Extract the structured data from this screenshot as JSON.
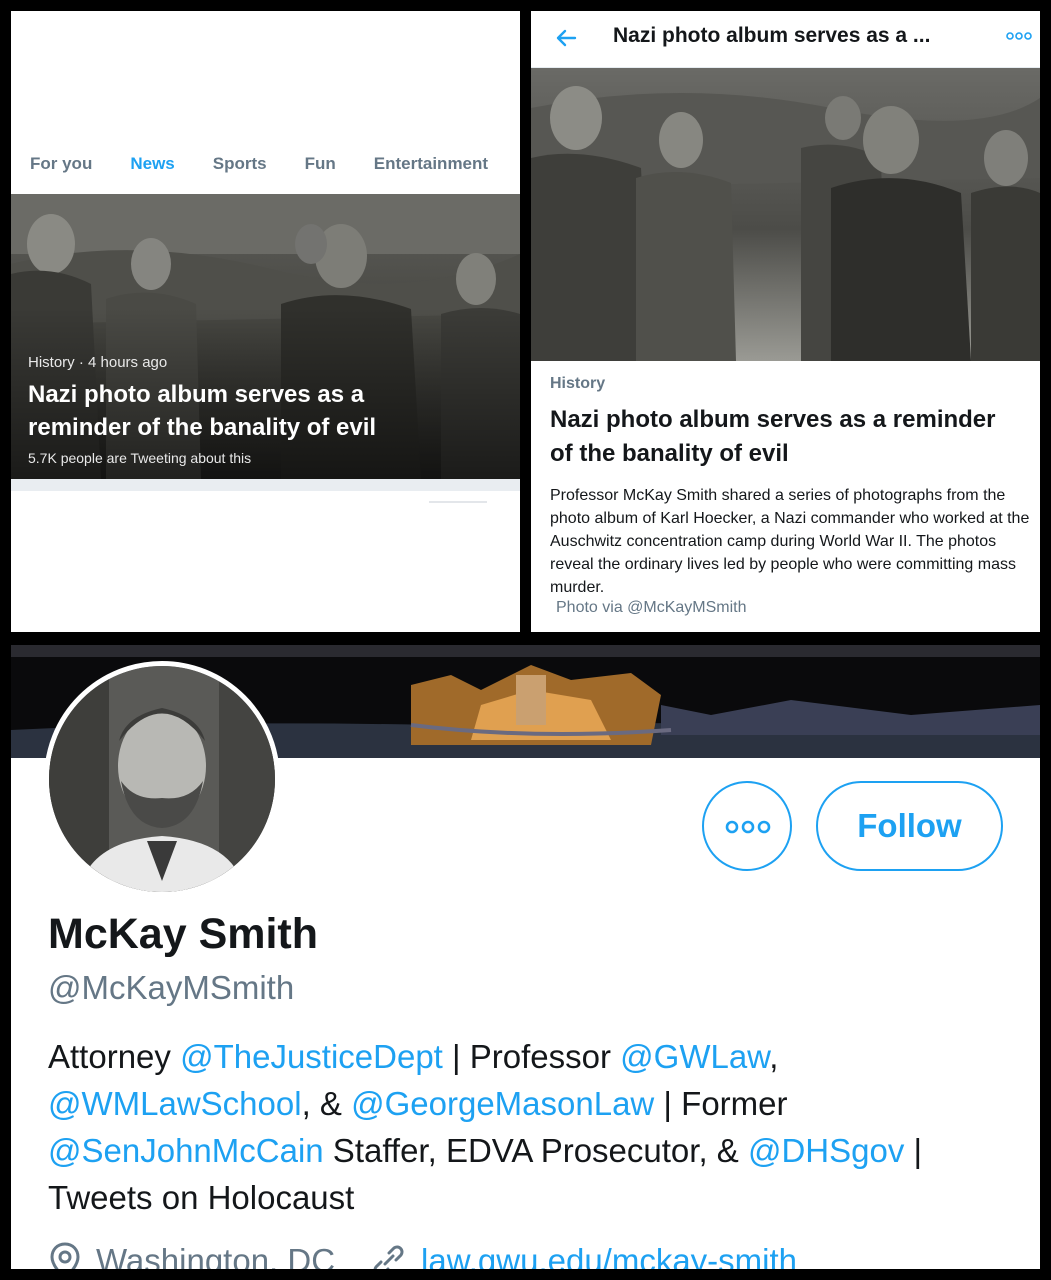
{
  "explore": {
    "tabs": [
      {
        "label": "For you"
      },
      {
        "label": "News"
      },
      {
        "label": "Sports"
      },
      {
        "label": "Fun"
      },
      {
        "label": "Entertainment"
      }
    ],
    "active_tab": "News",
    "hero": {
      "category": "History",
      "time": "4 hours ago",
      "title": "Nazi photo album serves as a reminder of the banality of evil",
      "tweet_count": "5.7K people are Tweeting about this"
    }
  },
  "article": {
    "header_title": "Nazi photo album serves as a ...",
    "category": "History",
    "title": "Nazi photo album serves as a reminder of the banality of evil",
    "body": "Professor McKay Smith shared a series of photographs from the photo album of Karl Hoecker, a Nazi commander who worked at the Auschwitz concentration camp during World War II. The photos reveal the ordinary lives led by people who were committing mass murder.",
    "credit": "Photo via @McKayMSmith"
  },
  "profile": {
    "name": "McKay Smith",
    "handle": "@McKayMSmith",
    "follow_label": "Follow",
    "bio": {
      "t1": "Attorney ",
      "m1": "@TheJusticeDept",
      "t2": " | Professor ",
      "m2": "@GWLaw",
      "t3": ", ",
      "m3": "@WMLawSchool",
      "t4": ", & ",
      "m4": "@GeorgeMasonLaw",
      "t5": " | Former ",
      "m5": "@SenJohnMcCain",
      "t6": " Staffer, EDVA Prosecutor, & ",
      "m6": "@DHSgov",
      "t7": " | Tweets on Holocaust"
    },
    "location": "Washington, DC",
    "website": "law.gwu.edu/mckay-smith"
  },
  "colors": {
    "accent": "#1da1f2",
    "secondary_text": "#657786",
    "primary_text": "#14171a"
  }
}
